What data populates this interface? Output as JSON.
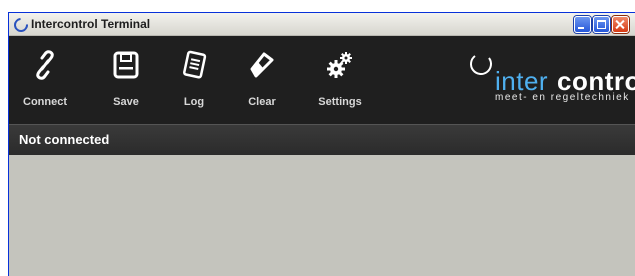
{
  "window": {
    "title": "Intercontrol Terminal"
  },
  "toolbar": {
    "items": [
      {
        "label": "Connect",
        "icon": "link-icon"
      },
      {
        "label": "Save",
        "icon": "floppy-disk-icon"
      },
      {
        "label": "Log",
        "icon": "log-notepad-icon"
      },
      {
        "label": "Clear",
        "icon": "eraser-icon"
      },
      {
        "label": "Settings",
        "icon": "gears-icon"
      }
    ]
  },
  "logo": {
    "brand_part1": "inter",
    "brand_part2": "control",
    "tagline": "meet- en regeltechniek"
  },
  "status": {
    "text": "Not connected"
  },
  "colors": {
    "toolbar_bg": "#1f1f1f",
    "logo_accent": "#4fb0f0",
    "content_bg": "#c4c4bd"
  }
}
